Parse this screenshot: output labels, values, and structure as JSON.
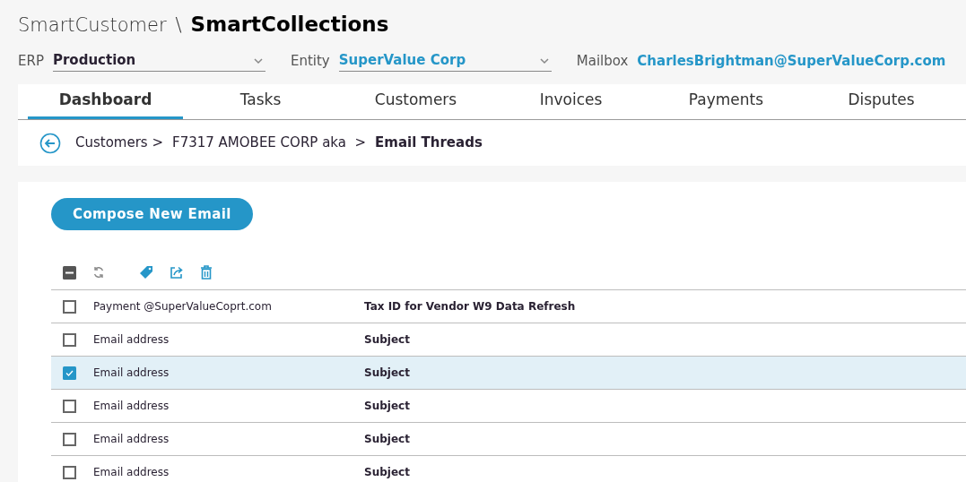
{
  "header": {
    "app": "SmartCustomer",
    "separator": "\\",
    "module": "SmartCollections"
  },
  "filters": [
    {
      "label": "ERP",
      "value": "Production",
      "kind": "dropdown",
      "accent": false
    },
    {
      "label": "Entity",
      "value": "SuperValue Corp",
      "kind": "dropdown",
      "accent": true
    },
    {
      "label": "Mailbox",
      "value": "CharlesBrightman@SuperValueCorp.com",
      "kind": "text",
      "accent": true
    }
  ],
  "tabs": [
    {
      "label": "Dashboard",
      "selected": true
    },
    {
      "label": "Tasks",
      "selected": false
    },
    {
      "label": "Customers",
      "selected": false
    },
    {
      "label": "Invoices",
      "selected": false
    },
    {
      "label": "Payments",
      "selected": false
    },
    {
      "label": "Disputes",
      "selected": false
    }
  ],
  "breadcrumb": [
    {
      "label": "Customers >",
      "current": false
    },
    {
      "label": "F7317 AMOBEE CORP aka  >",
      "current": false
    },
    {
      "label": "Email Threads",
      "current": true
    }
  ],
  "compose_button": "Compose New Email",
  "toolbar": {
    "select_all_indeterminate": true
  },
  "emails": [
    {
      "email": "Payment @SuperValueCoprt.com",
      "subject": "Tax ID for Vendor W9 Data Refresh",
      "selected": false
    },
    {
      "email": "Email address",
      "subject": "Subject",
      "selected": false
    },
    {
      "email": "Email address",
      "subject": "Subject",
      "selected": true
    },
    {
      "email": "Email address",
      "subject": "Subject",
      "selected": false
    },
    {
      "email": "Email address",
      "subject": "Subject",
      "selected": false
    },
    {
      "email": "Email address",
      "subject": "Subject",
      "selected": false
    }
  ]
}
